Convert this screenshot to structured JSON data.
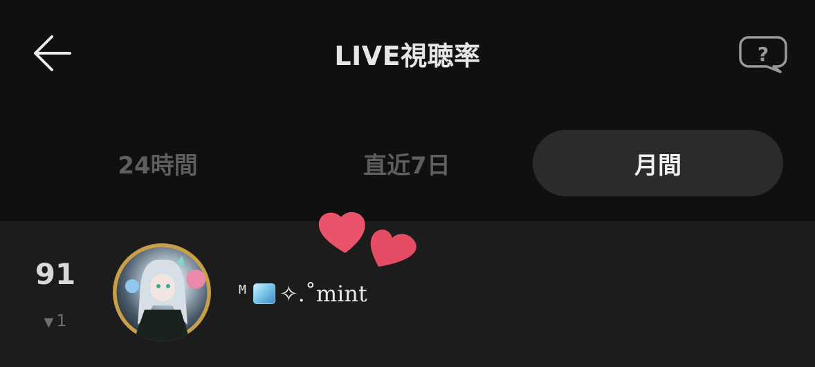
{
  "header": {
    "title": "LIVE視聴率",
    "back_icon": "arrow-left-icon",
    "help_icon": "question-bubble-icon"
  },
  "tabs": [
    {
      "label": "24時間",
      "active": false
    },
    {
      "label": "直近7日",
      "active": false
    },
    {
      "label": "月間",
      "active": true
    }
  ],
  "ranking": [
    {
      "rank": "91",
      "change_symbol": "▼",
      "change_value": "1",
      "name_prefix": "M",
      "name_emoji": "ice-cube",
      "name_text": "✧.˚mint"
    }
  ],
  "colors": {
    "background": "#101010",
    "list_background": "#1c1c1c",
    "active_tab_background": "#2b2b2b",
    "heart": "#e9546b"
  }
}
